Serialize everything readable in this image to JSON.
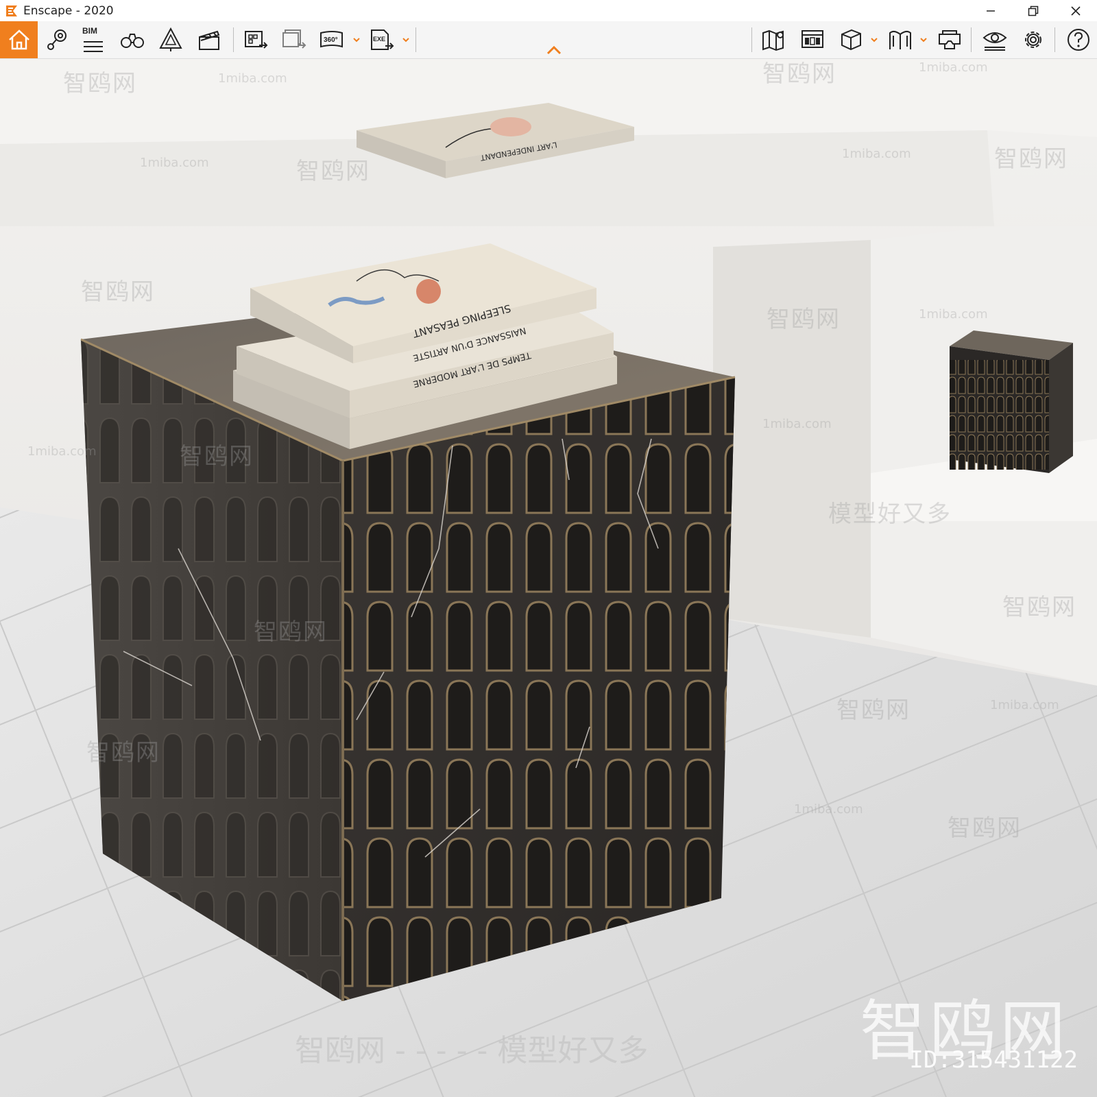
{
  "window": {
    "title": "Enscape - 2020",
    "brand_color": "#f07f1e"
  },
  "toolbar": {
    "items": [
      {
        "name": "home",
        "icon": "home-icon"
      },
      {
        "name": "view-management",
        "icon": "location-pin-icon"
      },
      {
        "name": "bim",
        "icon": "bim-list-icon",
        "label": "BIM"
      },
      {
        "name": "binoculars",
        "icon": "binoculars-icon"
      },
      {
        "name": "asset-library",
        "icon": "asset-tree-icon"
      },
      {
        "name": "video-editor",
        "icon": "clapperboard-icon"
      },
      {
        "name": "batch-render",
        "icon": "batch-render-icon"
      },
      {
        "name": "export-batch",
        "icon": "export-images-icon"
      },
      {
        "name": "panorama",
        "icon": "panorama-360-icon",
        "label": "360°"
      },
      {
        "name": "exe-export",
        "icon": "exe-export-icon",
        "label": "EXE"
      },
      {
        "name": "map",
        "icon": "map-icon"
      },
      {
        "name": "material-editor",
        "icon": "material-editor-icon"
      },
      {
        "name": "cube",
        "icon": "cube-icon"
      },
      {
        "name": "book",
        "icon": "book-icon"
      },
      {
        "name": "vr",
        "icon": "vr-headset-icon"
      },
      {
        "name": "visual-settings",
        "icon": "eye-settings-icon"
      },
      {
        "name": "general-settings",
        "icon": "gear-icon"
      },
      {
        "name": "help",
        "icon": "help-icon"
      }
    ]
  },
  "viewport": {
    "watermarks": {
      "site": "1miba.com",
      "brand": "智鸥网",
      "slogan": "模型好又多",
      "id_label": "ID:315431122"
    },
    "book_titles": [
      "SLEEPING PEASANT",
      "NAISSANCE D'UN ARTISTE",
      "TEMPS DE L'ART MODERNE",
      "L'ART INDEPENDANT"
    ]
  }
}
